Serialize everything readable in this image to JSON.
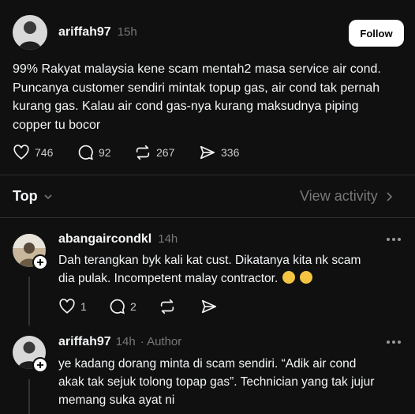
{
  "post": {
    "username": "ariffah97",
    "time": "15h",
    "follow_label": "Follow",
    "text_lines": [
      "99% Rakyat malaysia kene scam mentah2 masa service air cond.",
      "Puncanya customer sendiri mintak topup gas, air cond tak pernah",
      "kurang gas. Kalau air cond gas-nya kurang maksudnya piping",
      "copper tu bocor"
    ],
    "likes": "746",
    "comments": "92",
    "reposts": "267",
    "shares": "336"
  },
  "filter": {
    "top_label": "Top",
    "view_activity_label": "View activity"
  },
  "replies": [
    {
      "username": "abangaircondkl",
      "time": "14h",
      "text_lines": [
        "Dah terangkan byk kali kat cust. Dikatanya kita nk scam",
        "dia pulak. Incompetent malay contractor."
      ],
      "likes": "1",
      "comments": "2"
    },
    {
      "username": "ariffah97",
      "time": "14h",
      "author_label": "· Author",
      "text_lines": [
        "ye kadang dorang minta di scam sendiri. “Adik air cond",
        "akak tak sejuk tolong topap gas”. Technician yang tak jujur",
        "memang suka ayat ni"
      ]
    }
  ],
  "icons": {
    "like": "heart-icon",
    "comment": "comment-bubble-icon",
    "repost": "repost-icon",
    "share": "send-icon",
    "more": "more-dots-icon",
    "chevron": "chevron-down-icon",
    "chevron_right": "chevron-right-icon",
    "plus": "plus-icon"
  },
  "colors": {
    "background": "#101010",
    "text": "#f3f5f7",
    "muted": "#777777",
    "divider": "#2e2e2e"
  }
}
